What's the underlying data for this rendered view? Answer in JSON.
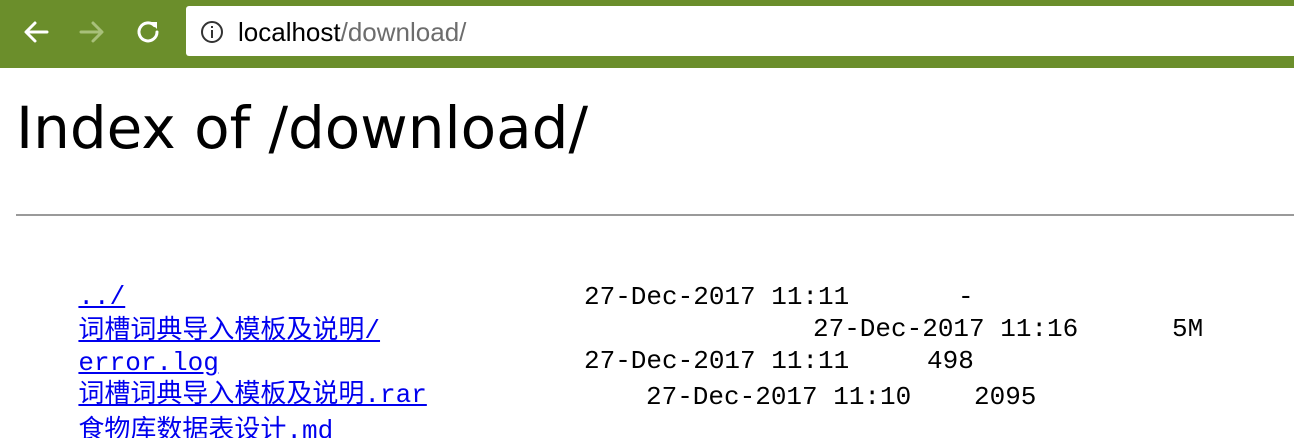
{
  "browser": {
    "address_bar": {
      "host": "localhost",
      "path": "/download/"
    },
    "toolbar_color": "#6b8e2b",
    "icons": {
      "back": "arrow-left-icon",
      "forward": "arrow-right-icon",
      "reload": "reload-icon",
      "site_info": "info-circle-icon"
    }
  },
  "page": {
    "heading": "Index of /download/",
    "link_color": "#0000ee"
  },
  "listing": {
    "entries": [
      {
        "name": "../",
        "date": "",
        "size": ""
      },
      {
        "name": "词槽词典导入模板及说明/",
        "date": "27-Dec-2017 11:11",
        "size": "-"
      },
      {
        "name": "error.log",
        "date": "27-Dec-2017 11:16",
        "size": "5M"
      },
      {
        "name": "词槽词典导入模板及说明.rar",
        "date": "27-Dec-2017 11:11",
        "size": "498"
      },
      {
        "name": "食物库数据表设计.md",
        "date": "27-Dec-2017 11:10",
        "size": "2095"
      }
    ]
  }
}
